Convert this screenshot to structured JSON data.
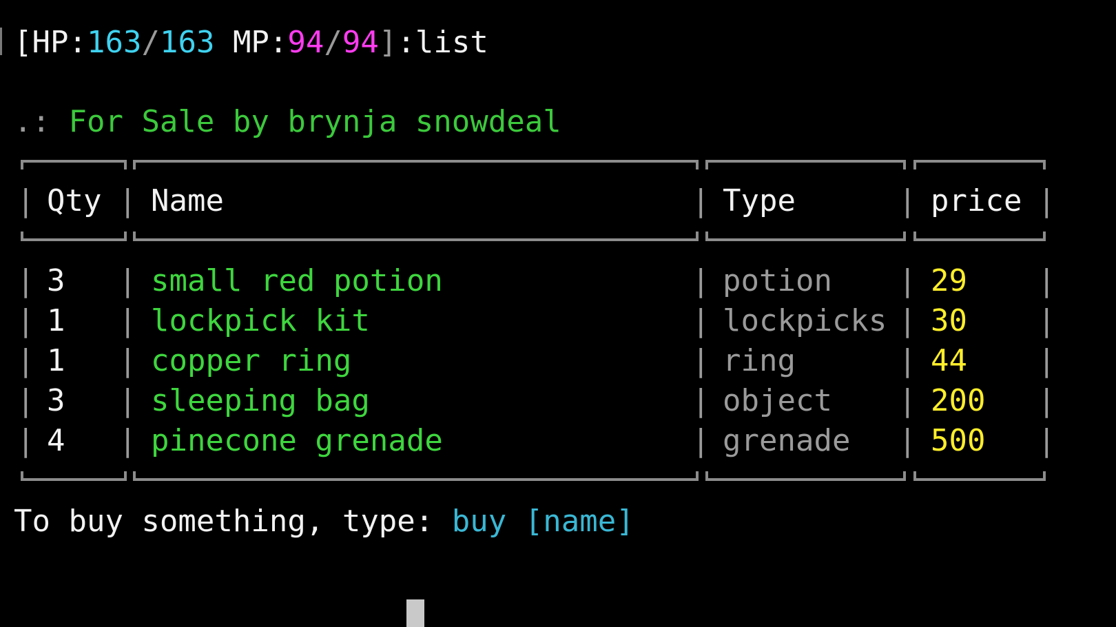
{
  "prompt": {
    "open": "[",
    "hp_label": "HP:",
    "hp_current": "163",
    "hp_sep": "/",
    "hp_max": "163",
    "mp_label": " MP:",
    "mp_current": "94",
    "mp_sep": "/",
    "mp_max": "94",
    "close": "]",
    "command": ":list"
  },
  "shop": {
    "header_prefix": ".: ",
    "header_text": "For Sale by brynja snowdeal"
  },
  "table": {
    "columns": [
      "Qty",
      "Name",
      "Type",
      "price"
    ],
    "rows": [
      {
        "qty": "3",
        "name": "small red potion",
        "type": "potion",
        "price": "29"
      },
      {
        "qty": "1",
        "name": "lockpick kit",
        "type": "lockpicks",
        "price": "30"
      },
      {
        "qty": "1",
        "name": "copper ring",
        "type": "ring",
        "price": "44"
      },
      {
        "qty": "3",
        "name": "sleeping bag",
        "type": "object",
        "price": "200"
      },
      {
        "qty": "4",
        "name": "pinecone grenade",
        "type": "grenade",
        "price": "500"
      }
    ]
  },
  "help": {
    "text": "To buy something, type: ",
    "command": "buy [name]"
  },
  "colors": {
    "background": "#000000",
    "hp": "#3fd2f0",
    "mp": "#ff3cf0",
    "item_name": "#3ed63e",
    "price": "#ffee2a",
    "type": "#9a9a9a",
    "command_hint": "#3ab7d4"
  }
}
